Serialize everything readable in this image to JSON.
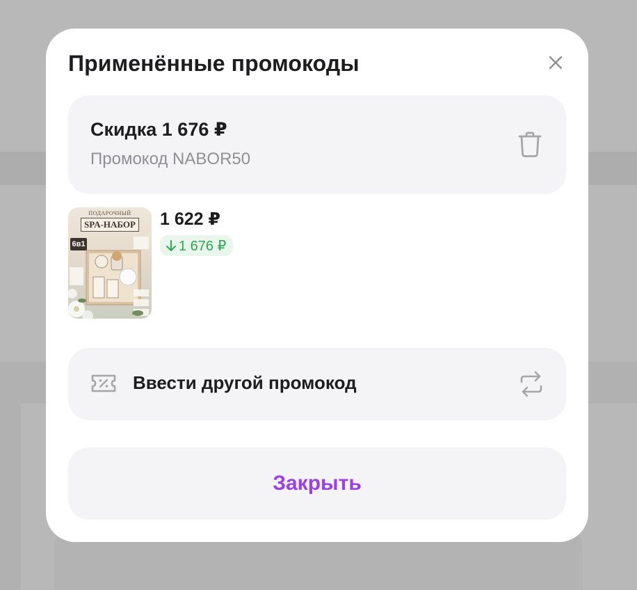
{
  "modal": {
    "title": "Применённые промокоды",
    "close_icon": "close-icon"
  },
  "discount": {
    "title": "Скидка 1 676 ₽",
    "code_text": "Промокод NABOR50",
    "delete_icon": "trash-icon"
  },
  "product": {
    "image_header_small": "ПОДАРОЧНЫЙ",
    "image_header_big": "SPA-НАБОР",
    "image_badge": "6в1",
    "price": "1 622 ₽",
    "discount_badge": "1 676 ₽",
    "discount_arrow_icon": "arrow-down-icon"
  },
  "other_promo": {
    "label": "Ввести другой промокод",
    "ticket_icon": "ticket-percent-icon",
    "swap_icon": "swap-arrows-icon"
  },
  "footer": {
    "close_label": "Закрыть"
  },
  "colors": {
    "accent": "#9b3fe6",
    "success": "#2fa84f",
    "card_bg": "#f4f4f6",
    "muted_text": "#8f8f95"
  }
}
